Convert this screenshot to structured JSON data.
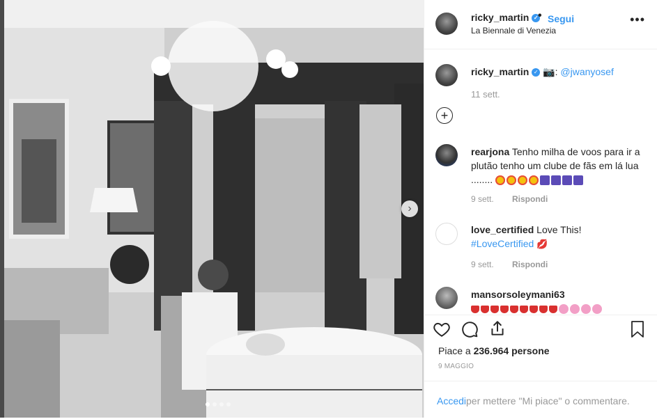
{
  "header": {
    "username": "ricky_martin",
    "verified_icon": "verified-check-icon",
    "follow_label": "Segui",
    "location": "La Biennale di Venezia",
    "more_icon": "more-options-icon"
  },
  "caption": {
    "username": "ricky_martin",
    "camera_emoji": "📷",
    "text": ":",
    "mention": "@jwanyosef",
    "time": "11 sett."
  },
  "load_more_icon": "plus-circle-icon",
  "comments": [
    {
      "username": "rearjona",
      "text": "Tenho milha de voos para ir a plutão tenho um clube de fãs em lá lua ........",
      "time": "9 sett.",
      "reply_label": "Rispondi"
    },
    {
      "username": "love_certified",
      "text": "Love This!",
      "hashtag": "#LoveCertified",
      "time": "9 sett.",
      "reply_label": "Rispondi"
    },
    {
      "username": "mansorsoleymani63",
      "text": ""
    }
  ],
  "actions": {
    "like_icon": "heart-icon",
    "comment_icon": "comment-icon",
    "share_icon": "share-icon",
    "save_icon": "bookmark-icon",
    "likes_prefix": "Piace a",
    "likes_count": "236.964",
    "likes_suffix": "persone",
    "date": "9 MAGGIO"
  },
  "login": {
    "link": "Accedi",
    "text": "per mettere \"Mi piace\" o commentare."
  },
  "colors": {
    "link_blue": "#3897f0",
    "text_dark": "#262626",
    "text_gray": "#999999"
  }
}
